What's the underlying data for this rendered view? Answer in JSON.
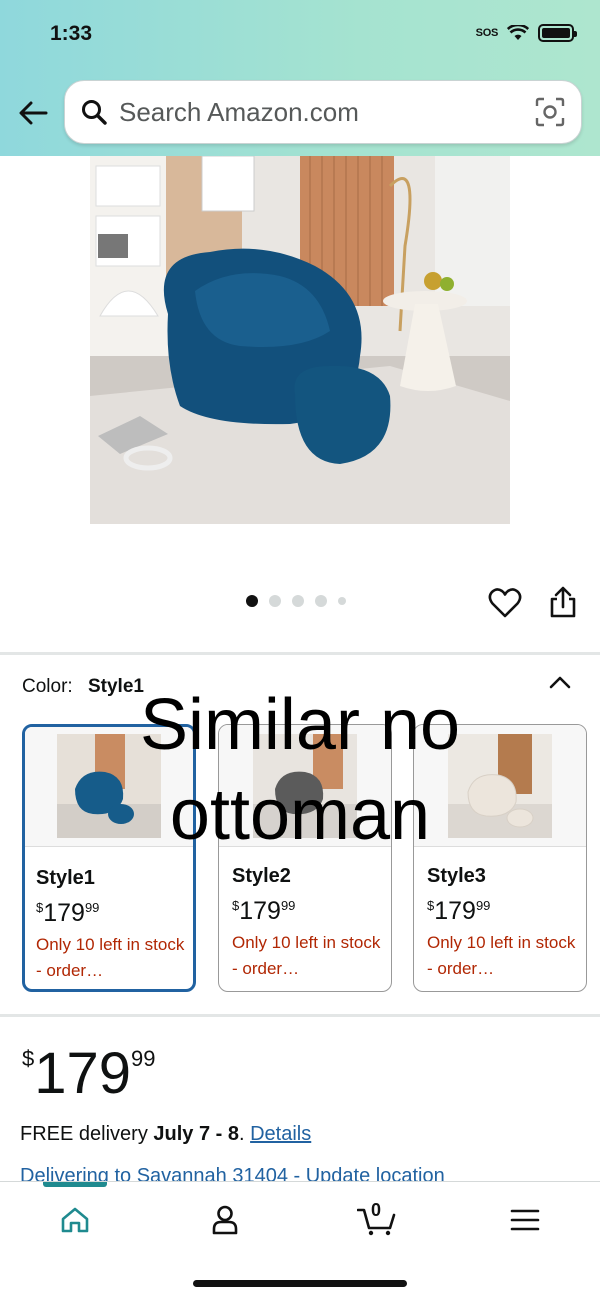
{
  "status_bar": {
    "time": "1:33",
    "sos": "SOS"
  },
  "search": {
    "placeholder": "Search Amazon.com"
  },
  "gallery": {
    "total_images": 5,
    "active_index": 0
  },
  "color_selector": {
    "label": "Color:",
    "selected": "Style1"
  },
  "styles": [
    {
      "name": "Style1",
      "price_whole": "179",
      "price_cents": "99",
      "currency": "$",
      "stock": "Only 10 left in stock - order…",
      "selected": true,
      "colour": "#1c5c84"
    },
    {
      "name": "Style2",
      "price_whole": "179",
      "price_cents": "99",
      "currency": "$",
      "stock": "Only 10 left in stock - order…",
      "selected": false,
      "colour": "#5b5b5b"
    },
    {
      "name": "Style3",
      "price_whole": "179",
      "price_cents": "99",
      "currency": "$",
      "stock": "Only 10 left in stock - order…",
      "selected": false,
      "colour": "#e8e2da"
    }
  ],
  "overlay_note": "Similar no ottoman",
  "price": {
    "currency": "$",
    "whole": "179",
    "cents": "99"
  },
  "delivery": {
    "prefix": "FREE delivery ",
    "dates": "July 7 - 8",
    "suffix": ". ",
    "details_link": "Details"
  },
  "location": {
    "text": "Delivering to Savannah 31404 - Update location"
  },
  "bottom_nav": {
    "cart_count": "0",
    "active": "home"
  },
  "colors": {
    "accent_teal": "#1f8a8f",
    "link": "#2162a1",
    "stock_red": "#b12704",
    "selected_border": "#2162a1"
  }
}
